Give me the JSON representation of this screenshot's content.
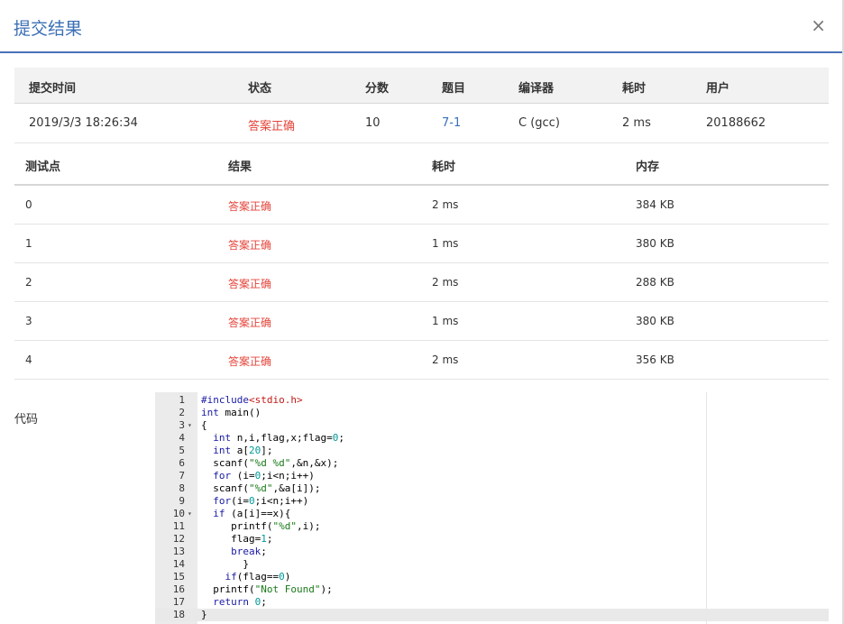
{
  "dialog": {
    "title": "提交结果",
    "close_label": "×"
  },
  "summary": {
    "headers": [
      "提交时间",
      "状态",
      "分数",
      "题目",
      "编译器",
      "耗时",
      "用户"
    ],
    "row": [
      "2019/3/3 18:26:34",
      "答案正确",
      "10",
      "7-1",
      "C (gcc)",
      "2 ms",
      "20188662"
    ]
  },
  "cases": {
    "headers": [
      "测试点",
      "结果",
      "耗时",
      "内存"
    ],
    "rows": [
      [
        "0",
        "答案正确",
        "2 ms",
        "384 KB"
      ],
      [
        "1",
        "答案正确",
        "1 ms",
        "380 KB"
      ],
      [
        "2",
        "答案正确",
        "2 ms",
        "288 KB"
      ],
      [
        "3",
        "答案正确",
        "1 ms",
        "380 KB"
      ],
      [
        "4",
        "答案正确",
        "2 ms",
        "356 KB"
      ]
    ]
  },
  "code": {
    "label": "代码",
    "lines": [
      "#include<stdio.h>",
      "int main()",
      "{",
      "  int n,i,flag,x;flag=0;",
      "  int a[20];",
      "  scanf(\"%d %d\",&n,&x);",
      "  for (i=0;i<n;i++)",
      "  scanf(\"%d\",&a[i]);",
      "  for(i=0;i<n;i++)",
      "  if (a[i]==x){",
      "     printf(\"%d\",i);",
      "     flag=1;",
      "     break;",
      "       }",
      "    if(flag==0)",
      "  printf(\"Not Found\");",
      "  return 0;",
      "}"
    ],
    "fold_lines": [
      3,
      10
    ],
    "active_line": 18
  },
  "colors": {
    "accent": "#3b6fb6",
    "status_ok": "#e4453b"
  }
}
